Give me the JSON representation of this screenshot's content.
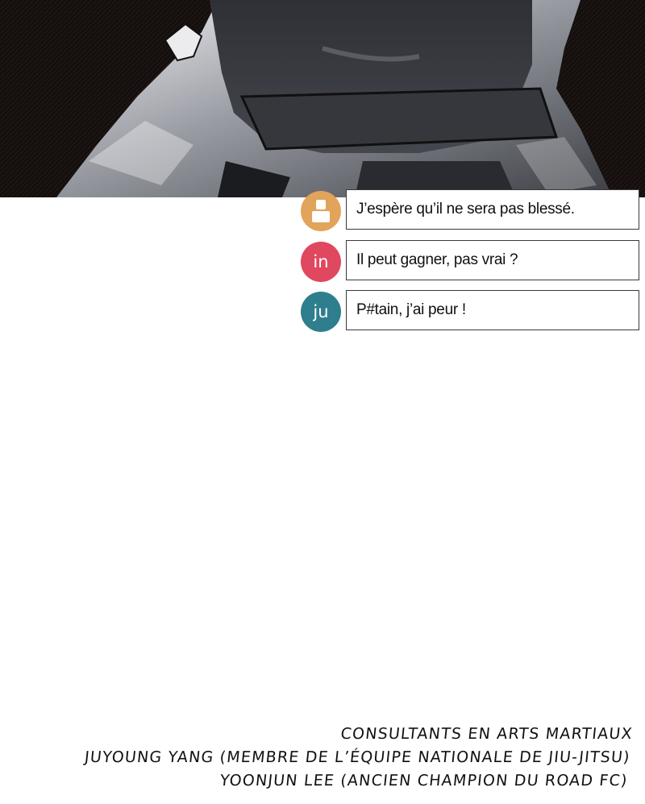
{
  "panel": {
    "icon": "figure-close-up-illustration"
  },
  "chat": {
    "messages": [
      {
        "avatar_text": "",
        "avatar_icon": "person-icon",
        "avatar_color": "#e2a35a",
        "text": "J’espère qu’il ne sera pas blessé."
      },
      {
        "avatar_text": "in",
        "avatar_color": "#e04860",
        "text": "Il peut gagner, pas vrai ?"
      },
      {
        "avatar_text": "ju",
        "avatar_color": "#2f7e8e",
        "text": "P#tain, j’ai peur !"
      }
    ]
  },
  "credits": {
    "line1": "CONSULTANTS EN ARTS MARTIAUX",
    "line2": "JUYOUNG YANG (MEMBRE DE L’ÉQUIPE NATIONALE DE JIU-JITSU)",
    "line3": "YOONJUN LEE (ANCIEN CHAMPION DU ROAD FC)"
  }
}
